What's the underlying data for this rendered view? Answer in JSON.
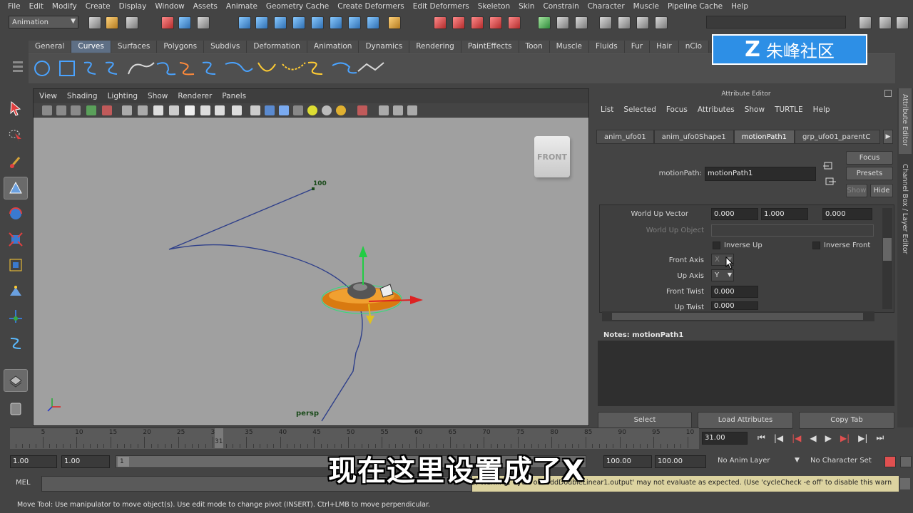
{
  "menubar": [
    "File",
    "Edit",
    "Modify",
    "Create",
    "Display",
    "Window",
    "Assets",
    "Animate",
    "Geometry Cache",
    "Create Deformers",
    "Edit Deformers",
    "Skeleton",
    "Skin",
    "Constrain",
    "Character",
    "Muscle",
    "Pipeline Cache",
    "Help"
  ],
  "statusline": {
    "mode": "Animation"
  },
  "shelf": {
    "tabs": [
      "General",
      "Curves",
      "Surfaces",
      "Polygons",
      "Subdivs",
      "Deformation",
      "Animation",
      "Dynamics",
      "Rendering",
      "PaintEffects",
      "Toon",
      "Muscle",
      "Fluids",
      "Fur",
      "Hair",
      "nClo"
    ],
    "active": "Curves"
  },
  "logo": {
    "text": "朱峰社区"
  },
  "viewport": {
    "menu": [
      "View",
      "Shading",
      "Lighting",
      "Show",
      "Renderer",
      "Panels"
    ],
    "cube_label": "FRONT",
    "camera_label": "persp",
    "path_marker": "100"
  },
  "attribute_editor": {
    "title": "Attribute Editor",
    "menu": [
      "List",
      "Selected",
      "Focus",
      "Attributes",
      "Show",
      "TURTLE",
      "Help"
    ],
    "tabs": [
      "anim_ufo01",
      "anim_ufo0Shape1",
      "motionPath1",
      "grp_ufo01_parentC"
    ],
    "active_tab": "motionPath1",
    "node_label": "motionPath:",
    "node_value": "motionPath1",
    "buttons": {
      "focus": "Focus",
      "presets": "Presets",
      "show": "Show",
      "hide": "Hide"
    },
    "attrs": {
      "world_up_vector_label": "World Up Vector",
      "world_up_vector": [
        "0.000",
        "1.000",
        "0.000"
      ],
      "world_up_object_label": "World Up Object",
      "inverse_up": "Inverse Up",
      "inverse_front": "Inverse Front",
      "front_axis_label": "Front Axis",
      "front_axis_value": "X",
      "up_axis_label": "Up Axis",
      "up_axis_value": "Y",
      "front_twist_label": "Front Twist",
      "front_twist_value": "0.000",
      "up_twist_label": "Up Twist",
      "up_twist_value": "0.000"
    },
    "notes_label": "Notes:  motionPath1",
    "bottom_buttons": [
      "Select",
      "Load Attributes",
      "Copy Tab"
    ]
  },
  "side_tabs": [
    "Attribute Editor",
    "Channel Box / Layer Editor"
  ],
  "timeline": {
    "ticks": [
      "5",
      "10",
      "15",
      "20",
      "25",
      "30",
      "35",
      "40",
      "45",
      "50",
      "55",
      "60",
      "65",
      "70",
      "75",
      "80",
      "85",
      "90",
      "95",
      "10"
    ],
    "current_frame_marker": "31",
    "current_time": "31.00"
  },
  "range": {
    "start_a": "1.00",
    "start_b": "1.00",
    "range_label": "1",
    "end_a": "100.00",
    "end_b": "100.00",
    "anim_layer": "No Anim Layer",
    "character_set": "No Character Set"
  },
  "command_line": {
    "label": "MEL",
    "warning": "// Warning: Cycle on 'addDoubleLinear1.output' may not evaluate as expected.  (Use 'cycleCheck -e off' to disable this warn"
  },
  "help_line": "Move Tool: Use manipulator to move object(s). Use edit mode to change pivot (INSERT).  Ctrl+LMB to move perpendicular.",
  "subtitle": "现在这里设置成了X"
}
